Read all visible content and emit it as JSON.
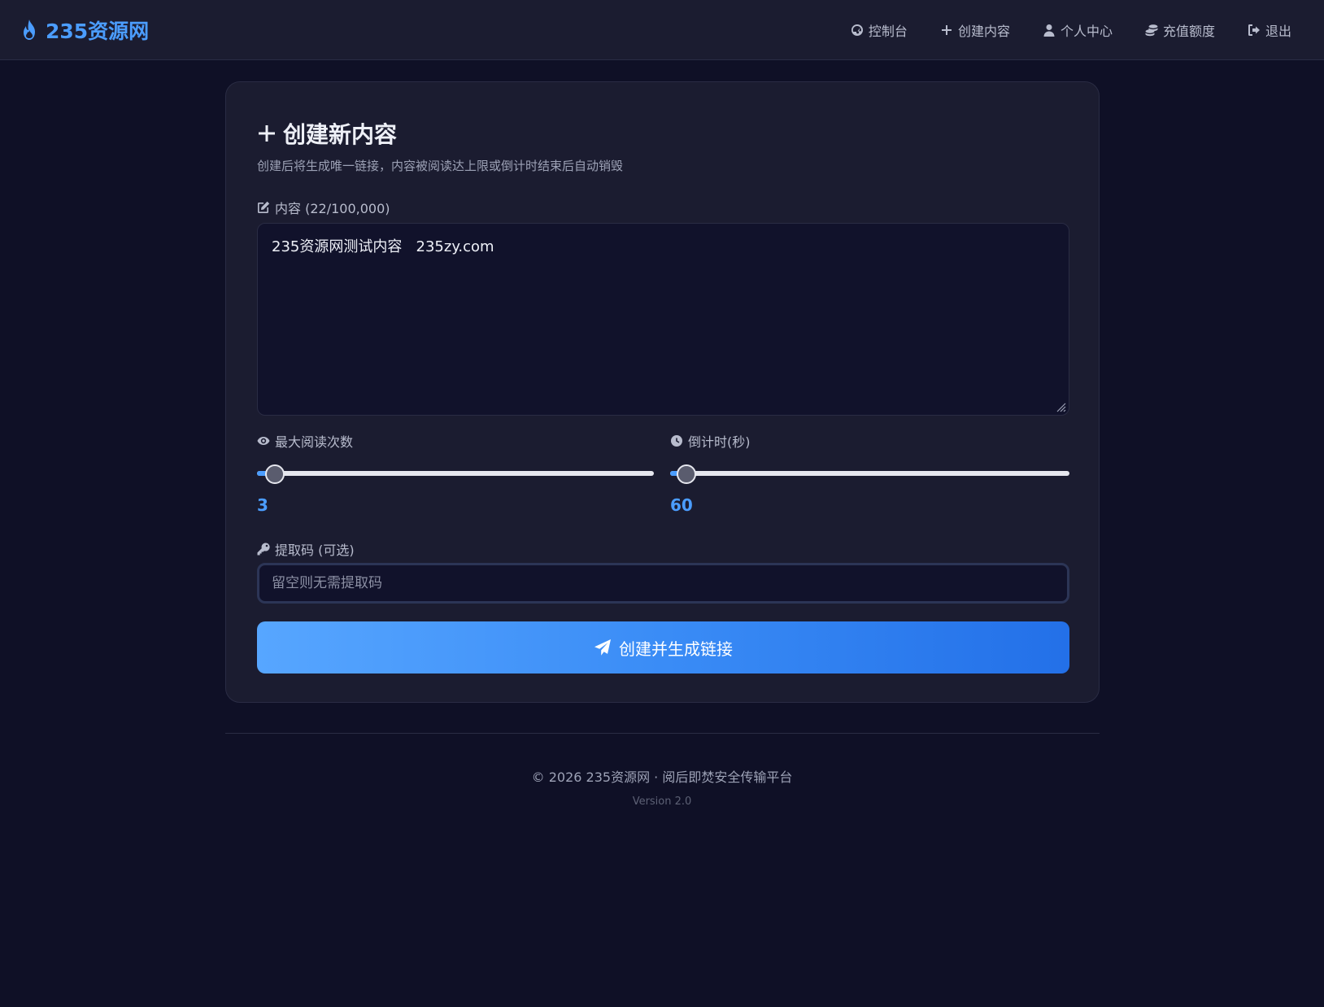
{
  "brand": {
    "name": "235资源网",
    "icon": "flame-icon",
    "color": "#4b9dff"
  },
  "nav": {
    "items": [
      {
        "label": "控制台",
        "icon": "dashboard-icon"
      },
      {
        "label": "创建内容",
        "icon": "plus-icon"
      },
      {
        "label": "个人中心",
        "icon": "user-icon"
      },
      {
        "label": "充值额度",
        "icon": "coins-icon"
      },
      {
        "label": "退出",
        "icon": "logout-icon"
      }
    ]
  },
  "form": {
    "title": "创建新内容",
    "subtitle": "创建后将生成唯一链接，内容被阅读达上限或倒计时结束后自动销毁",
    "content_label": "内容 (22/100,000)",
    "content_value": "235资源网测试内容   235zy.com",
    "max_reads_label": "最大阅读次数",
    "max_reads": {
      "value": 3,
      "fill_fraction": 0.045
    },
    "countdown_label": "倒计时(秒)",
    "countdown": {
      "value": 60,
      "fill_fraction": 0.04
    },
    "code_label": "提取码 (可选)",
    "code_placeholder": "留空则无需提取码",
    "code_value": "",
    "submit_label": "创建并生成链接"
  },
  "footer": {
    "copyright": "© 2026 235资源网 · 阅后即焚安全传输平台",
    "version": "Version 2.0"
  },
  "colors": {
    "background": "#0f1026",
    "surface": "#1b1c30",
    "accent": "#4b9dff",
    "button_gradient_start": "#57a6ff",
    "button_gradient_end": "#2370e8"
  }
}
